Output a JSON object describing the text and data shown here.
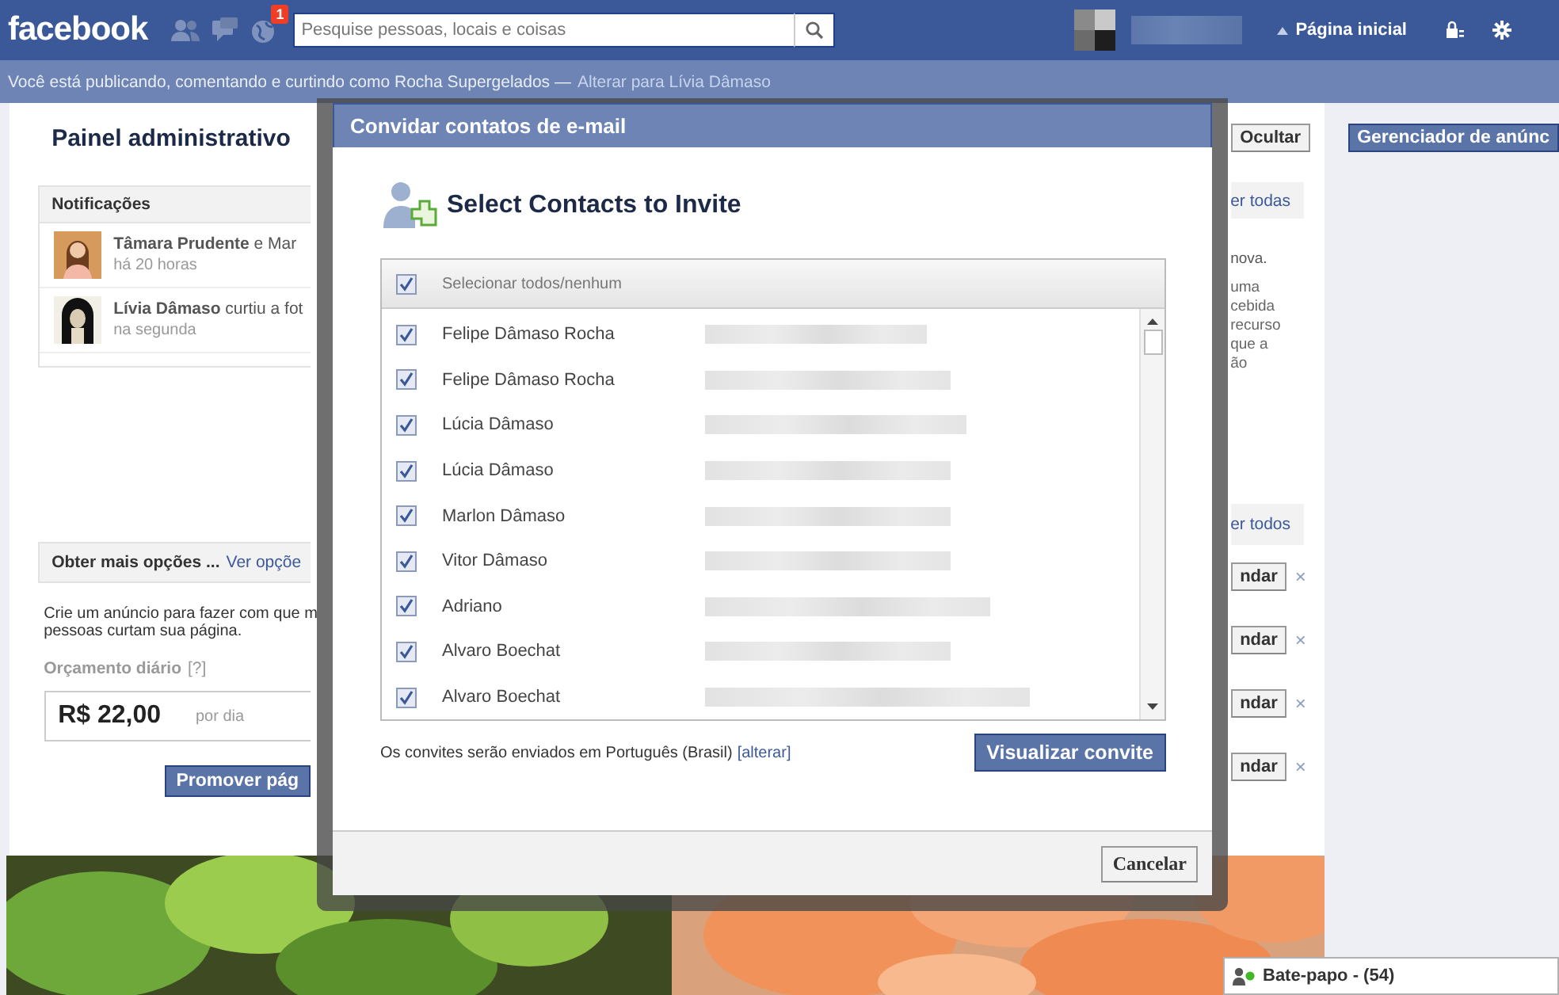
{
  "top_bar": {
    "logo": "facebook",
    "notifications_badge": "1",
    "search": {
      "placeholder": "Pesquise pessoas, locais e coisas"
    },
    "home_link": "Página inicial"
  },
  "identity_bar": {
    "text": "Você está publicando, comentando e curtindo como Rocha Supergelados —",
    "link": "Alterar para Lívia Dâmaso"
  },
  "page": {
    "title": "Painel administrativo",
    "hide_button": "Ocultar",
    "notifications": {
      "title": "Notificações",
      "see_all": "er todas",
      "items": [
        {
          "text": "**Tâmara Prudente** e Mar",
          "time": "há 20 horas"
        },
        {
          "text": "**Lívia Dâmaso** curtiu a fot",
          "time": "na segunda"
        }
      ]
    },
    "side_text": [
      "nova.",
      "uma",
      "cebida",
      "recurso",
      "que a",
      "ão"
    ],
    "options": {
      "title": "Obter mais opções ...",
      "link": "Ver opçõe",
      "see_all": "er todos"
    },
    "promo_text": [
      "Crie um anúncio para fazer com que m",
      "pessoas curtam sua página."
    ],
    "budget": {
      "label": "Orçamento diário",
      "help": "[?]",
      "value": "R$ 22,00",
      "unit": "por dia"
    },
    "promote_button": "Promover pág",
    "suggestions": [
      {
        "button": "ndar",
        "dismiss": "×"
      },
      {
        "button": "ndar",
        "dismiss": "×"
      },
      {
        "button": "ndar",
        "dismiss": "×"
      },
      {
        "button": "ndar",
        "dismiss": "×"
      }
    ]
  },
  "sidebar": {
    "ads_button": "Gerenciador de anúnc"
  },
  "chat": {
    "label": "Bate-papo - (54)"
  },
  "dialog": {
    "title": "Convidar contatos de e-mail",
    "heading": "Select Contacts to Invite",
    "select_all": {
      "label": "Selecionar todos/nenhum",
      "checked": true
    },
    "contacts": [
      {
        "name": "Felipe Dâmaso Rocha",
        "checked": true
      },
      {
        "name": "Felipe Dâmaso Rocha",
        "checked": true
      },
      {
        "name": "Lúcia Dâmaso",
        "checked": true
      },
      {
        "name": "Lúcia Dâmaso",
        "checked": true
      },
      {
        "name": "Marlon Dâmaso",
        "checked": true
      },
      {
        "name": "Vitor Dâmaso",
        "checked": true
      },
      {
        "name": "Adriano",
        "checked": true
      },
      {
        "name": "Alvaro Boechat",
        "checked": true
      },
      {
        "name": "Alvaro Boechat",
        "checked": true
      }
    ],
    "language_note": "Os convites serão enviados em Português (Brasil)",
    "change_link": "[alterar]",
    "preview_button": "Visualizar convite",
    "cancel_button": "Cancelar"
  }
}
